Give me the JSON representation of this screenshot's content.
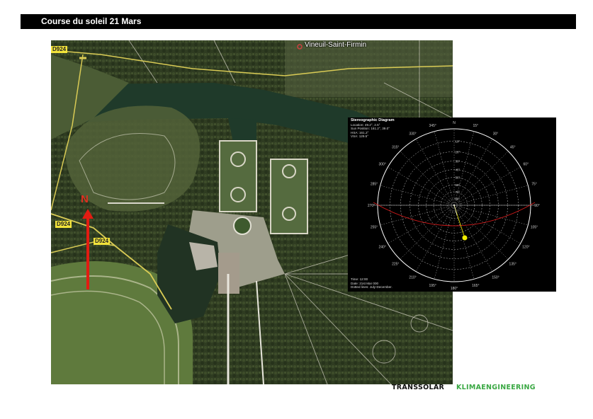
{
  "header": {
    "title": "Course du soleil 21 Mars"
  },
  "map": {
    "place_name": "Vineuil-Saint-Firmin",
    "road_labels": [
      "D924",
      "D924",
      "D924"
    ],
    "north_label": "N"
  },
  "diagram": {
    "title": "Stereographic Diagram",
    "info_lines": [
      "Location: 49.2°, 2.5°",
      "Sun Position: 161.2°, 39.0°",
      "HSA: 161.2°",
      "VSA: 129.5°"
    ],
    "footer_lines": [
      "Time: 12:00",
      "Date: 21st Mar 000",
      "Dotted lines: July-December."
    ],
    "azimuth_labels": [
      "N",
      "15°",
      "30°",
      "45°",
      "60°",
      "75°",
      "90°",
      "105°",
      "120°",
      "135°",
      "150°",
      "165°",
      "180°",
      "195°",
      "210°",
      "225°",
      "240°",
      "255°",
      "270°",
      "285°",
      "300°",
      "315°",
      "330°",
      "345°"
    ],
    "altitude_labels": [
      "10°",
      "20°",
      "30°",
      "40°",
      "50°",
      "60°",
      "70°",
      "80°"
    ],
    "colors": {
      "sun_path": "#cc1a1a",
      "sun": "#f2ee00",
      "grid": "#cfcfcf"
    }
  },
  "footer": {
    "brand_left": "TRANSSOLAR",
    "brand_right": "KLIMAENGINEERING",
    "brand_right_color": "#3aa843"
  }
}
